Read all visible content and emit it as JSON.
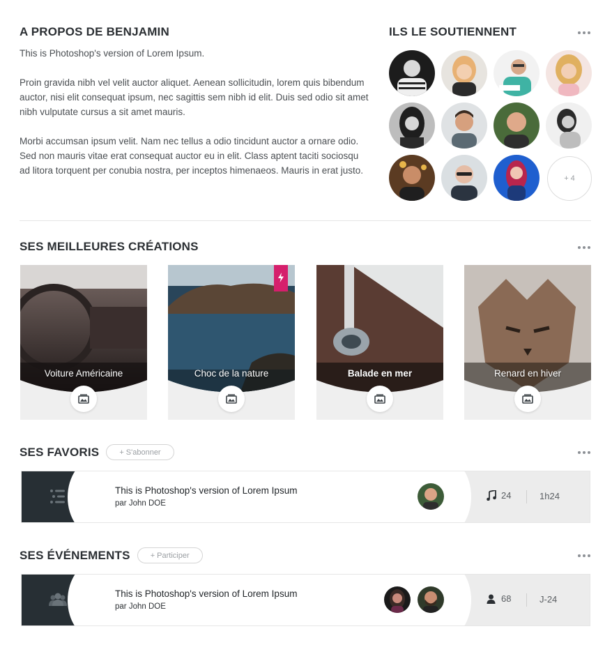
{
  "about": {
    "title": "A PROPOS DE BENJAMIN",
    "paragraphs": [
      "This is Photoshop's version  of Lorem Ipsum.",
      "Proin gravida nibh vel velit auctor aliquet. Aenean sollicitudin, lorem quis bibendum auctor, nisi elit consequat ipsum, nec sagittis sem nibh id elit. Duis sed odio sit amet nibh vulputate cursus a sit amet mauris.",
      "Morbi accumsan ipsum velit. Nam nec tellus a odio tincidunt auctor a ornare odio. Sed non  mauris vitae erat consequat auctor eu in elit. Class aptent taciti sociosqu ad litora torquent per conubia nostra, per inceptos himenaeos. Mauris in erat justo."
    ]
  },
  "supporters": {
    "title": "ILS LE SOUTIENNENT",
    "more_label": "+ 4"
  },
  "creations": {
    "title": "SES MEILLEURES CRÉATIONS",
    "items": [
      {
        "title": "Voiture Américaine"
      },
      {
        "title": "Choc de la nature"
      },
      {
        "title": "Balade en mer"
      },
      {
        "title": "Renard en hiver"
      }
    ]
  },
  "favorites": {
    "title": "SES FAVORIS",
    "action_label": "+ S'abonner",
    "item": {
      "title": "This is Photoshop's version  of Lorem Ipsum",
      "author": "par John DOE",
      "count": "24",
      "duration": "1h24"
    }
  },
  "events": {
    "title": "SES ÉVÉNEMENTS",
    "action_label": "+ Participer",
    "item": {
      "title": "This is Photoshop's version  of Lorem Ipsum",
      "author": "par John DOE",
      "count": "68",
      "deadline": "J-24"
    }
  },
  "colors": {
    "dark_thumb": "#272f34",
    "ribbon": "#d51f6c",
    "stats_bg": "#ececec"
  }
}
